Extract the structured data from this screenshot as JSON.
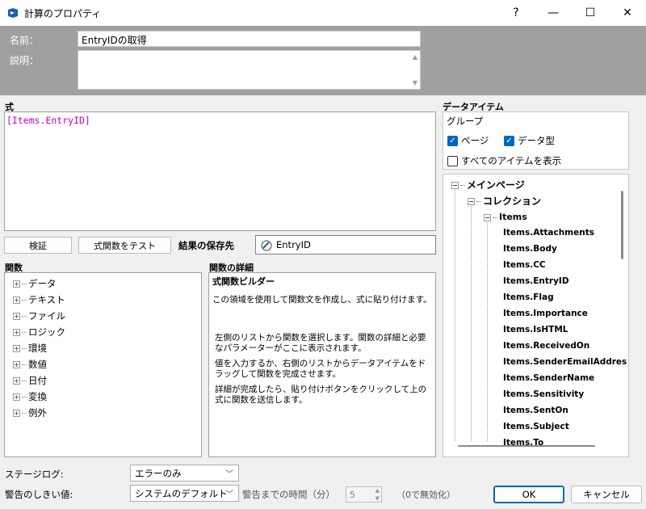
{
  "window": {
    "title": "計算のプロパティ",
    "help_glyph": "?",
    "minimize_glyph": "—",
    "maximize_glyph": "☐",
    "close_glyph": "✕"
  },
  "header": {
    "name_label": "名前：",
    "name_value": "EntryIDの取得",
    "description_label": "説明：",
    "description_value": "",
    "scroll_up": "▲",
    "scroll_down": "▼"
  },
  "formula": {
    "label": "式",
    "value": "[Items.EntryID]"
  },
  "buttons": {
    "validate": "検証",
    "test_function": "式関数をテスト",
    "ok": "OK",
    "cancel": "キャンセル"
  },
  "result": {
    "label": "結果の保存先",
    "value": "EntryID"
  },
  "functions": {
    "label": "関数",
    "items": [
      "データ",
      "テキスト",
      "ファイル",
      "ロジック",
      "環境",
      "数値",
      "日付",
      "変換",
      "例外"
    ]
  },
  "function_detail": {
    "label": "関数の詳細",
    "heading": "式関数ビルダー",
    "paragraphs": [
      "この領域を使用して関数文を作成し、式に貼り付けます。",
      "左側のリストから関数を選択します。関数の詳細と必要なパラメーターがここに表示されます。",
      "値を入力するか、右側のリストからデータアイテムをドラッグして関数を完成させます。",
      "詳細が完成したら、貼り付けボタンをクリックして上の式に関数を送信します。"
    ]
  },
  "data_items": {
    "label": "データアイテム",
    "group_label": "グループ",
    "checkbox_page": "ページ",
    "checkbox_datatype": "データ型",
    "checkbox_show_all": "すべてのアイテムを表示",
    "tree_main": "メインページ",
    "tree_collection": "コレクション",
    "tree_items": "Items",
    "fields": [
      "Items.Attachments",
      "Items.Body",
      "Items.CC",
      "Items.EntryID",
      "Items.Flag",
      "Items.Importance",
      "Items.IsHTML",
      "Items.ReceivedOn",
      "Items.SenderEmailAddres",
      "Items.SenderName",
      "Items.Sensitivity",
      "Items.SentOn",
      "Items.Subject",
      "Items.To"
    ]
  },
  "footer": {
    "stage_log_label": "ステージログ:",
    "stage_log_value": "エラーのみ",
    "warning_label": "警告のしきい値:",
    "warning_value": "システムのデフォルト",
    "time_label": "警告までの時間（分）",
    "time_value": "5",
    "disabled_note": "（0で無効化）"
  },
  "colors": {
    "header_bg": "#a0a0a0",
    "formula_text": "#c000c0",
    "accent": "#0067c0"
  }
}
